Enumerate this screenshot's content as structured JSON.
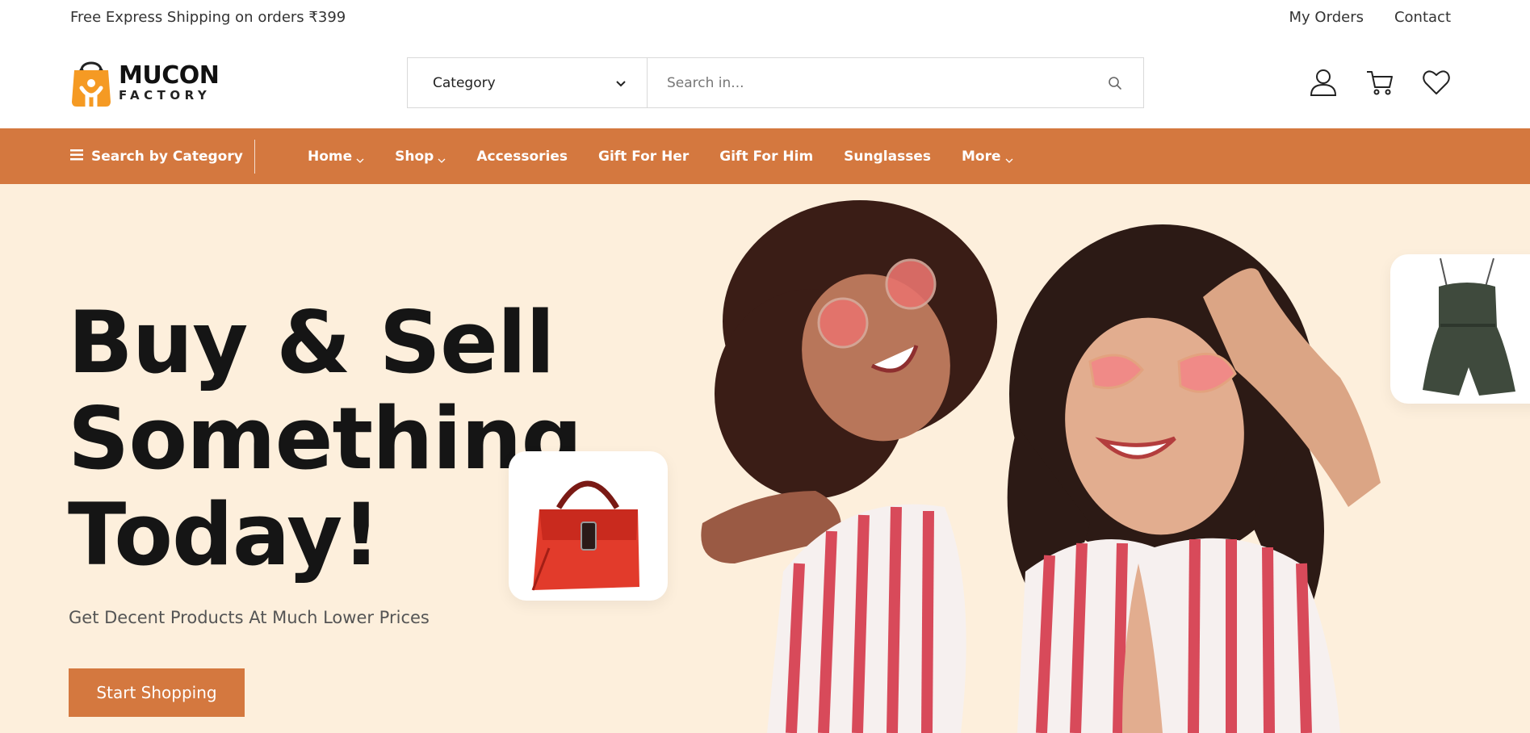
{
  "topbar": {
    "shipping_text": "Free Express Shipping on orders ₹399",
    "links": [
      "My Orders",
      "Contact"
    ]
  },
  "header": {
    "logo": {
      "line1": "MUCON",
      "line2": "FACTORY"
    },
    "search": {
      "category_label": "Category",
      "placeholder": "Search in...",
      "icon": "search-icon"
    },
    "icons": [
      "account-icon",
      "cart-icon",
      "wishlist-heart-icon"
    ]
  },
  "nav": {
    "category_button": "Search by Category",
    "items": [
      {
        "label": "Home",
        "dropdown": true
      },
      {
        "label": "Shop",
        "dropdown": true
      },
      {
        "label": "Accessories",
        "dropdown": false
      },
      {
        "label": "Gift For Her",
        "dropdown": false
      },
      {
        "label": "Gift For Him",
        "dropdown": false
      },
      {
        "label": "Sunglasses",
        "dropdown": false
      },
      {
        "label": "More",
        "dropdown": true
      }
    ]
  },
  "hero": {
    "headline_lines": [
      "Buy & Sell",
      "Something",
      "Today!"
    ],
    "subtext": "Get Decent Products At Much Lower Prices",
    "cta_label": "Start Shopping"
  },
  "colors": {
    "accent": "#d4783f",
    "hero_bg": "#fdefdc",
    "text_dark": "#151515",
    "logo_orange": "#f59a23"
  }
}
